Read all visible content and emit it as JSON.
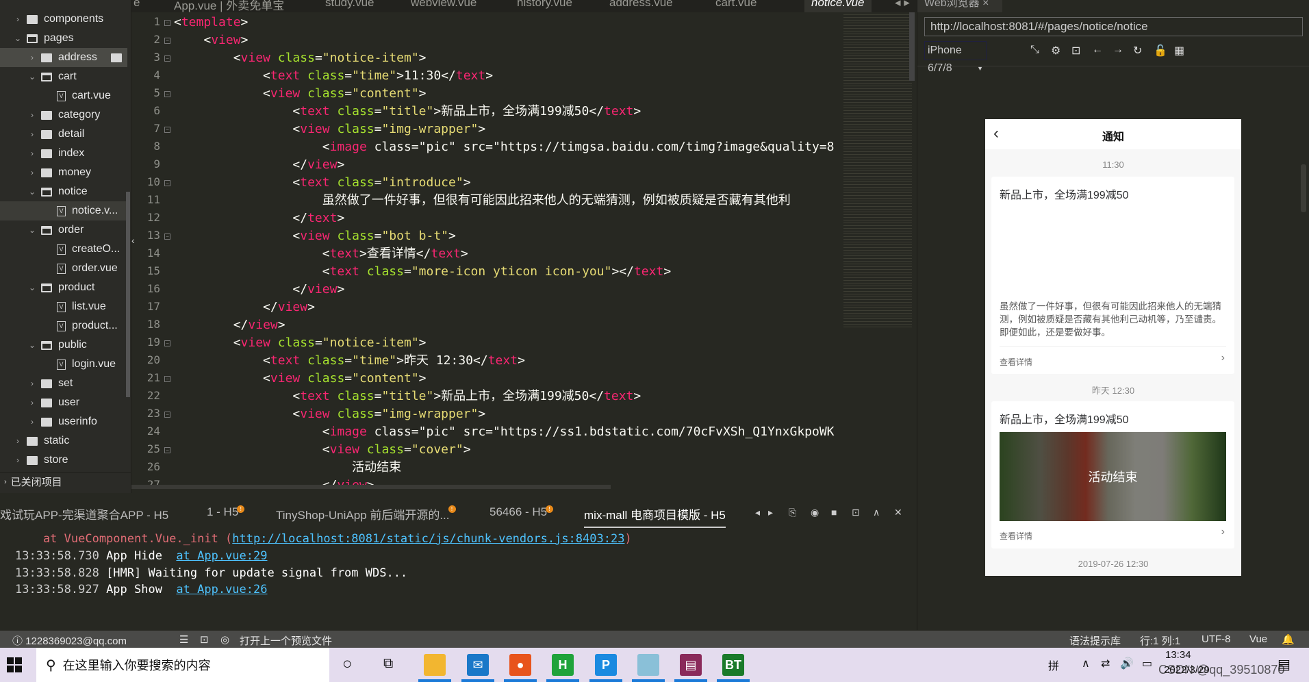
{
  "sidebar": {
    "items": [
      {
        "label": "components",
        "depth": 0,
        "kind": "folder",
        "open": false
      },
      {
        "label": "pages",
        "depth": 0,
        "kind": "folder",
        "open": true
      },
      {
        "label": "address",
        "depth": 1,
        "kind": "folder",
        "open": false,
        "selected": true
      },
      {
        "label": "cart",
        "depth": 1,
        "kind": "folder",
        "open": true
      },
      {
        "label": "cart.vue",
        "depth": 2,
        "kind": "file"
      },
      {
        "label": "category",
        "depth": 1,
        "kind": "folder",
        "open": false
      },
      {
        "label": "detail",
        "depth": 1,
        "kind": "folder",
        "open": false
      },
      {
        "label": "index",
        "depth": 1,
        "kind": "folder",
        "open": false
      },
      {
        "label": "money",
        "depth": 1,
        "kind": "folder",
        "open": false
      },
      {
        "label": "notice",
        "depth": 1,
        "kind": "folder",
        "open": true
      },
      {
        "label": "notice.v...",
        "depth": 2,
        "kind": "file",
        "active": true
      },
      {
        "label": "order",
        "depth": 1,
        "kind": "folder",
        "open": true
      },
      {
        "label": "createO...",
        "depth": 2,
        "kind": "file"
      },
      {
        "label": "order.vue",
        "depth": 2,
        "kind": "file"
      },
      {
        "label": "product",
        "depth": 1,
        "kind": "folder",
        "open": true
      },
      {
        "label": "list.vue",
        "depth": 2,
        "kind": "file"
      },
      {
        "label": "product...",
        "depth": 2,
        "kind": "file"
      },
      {
        "label": "public",
        "depth": 1,
        "kind": "folder",
        "open": true
      },
      {
        "label": "login.vue",
        "depth": 2,
        "kind": "file"
      },
      {
        "label": "set",
        "depth": 1,
        "kind": "folder",
        "open": false
      },
      {
        "label": "user",
        "depth": 1,
        "kind": "folder",
        "open": false
      },
      {
        "label": "userinfo",
        "depth": 1,
        "kind": "folder",
        "open": false
      },
      {
        "label": "static",
        "depth": 0,
        "kind": "folder",
        "open": false
      },
      {
        "label": "store",
        "depth": 0,
        "kind": "folder",
        "open": false
      }
    ],
    "closed_projects": "已关闭项目"
  },
  "editor": {
    "tabs": [
      {
        "label": "e"
      },
      {
        "label": "App.vue | 外卖免单宝"
      },
      {
        "label": "study.vue"
      },
      {
        "label": "webview.vue"
      },
      {
        "label": "history.vue"
      },
      {
        "label": "address.vue"
      },
      {
        "label": "cart.vue"
      },
      {
        "label": "notice.vue",
        "active": true
      }
    ],
    "lines": [
      "<template>",
      "    <view>",
      "        <view class=\"notice-item\">",
      "            <text class=\"time\">11:30</text>",
      "            <view class=\"content\">",
      "                <text class=\"title\">新品上市，全场满199减50</text>",
      "                <view class=\"img-wrapper\">",
      "                    <image class=\"pic\" src=\"https://timgsa.baidu.com/timg?image&quality=8",
      "                </view>",
      "                <text class=\"introduce\">",
      "                    虽然做了一件好事，但很有可能因此招来他人的无端猜测，例如被质疑是否藏有其他利",
      "                </text>",
      "                <view class=\"bot b-t\">",
      "                    <text>查看详情</text>",
      "                    <text class=\"more-icon yticon icon-you\"></text>",
      "                </view>",
      "            </view>",
      "        </view>",
      "        <view class=\"notice-item\">",
      "            <text class=\"time\">昨天 12:30</text>",
      "            <view class=\"content\">",
      "                <text class=\"title\">新品上市，全场满199减50</text>",
      "                <view class=\"img-wrapper\">",
      "                    <image class=\"pic\" src=\"https://ss1.bdstatic.com/70cFvXSh_Q1YnxGkpoWK",
      "                    <view class=\"cover\">",
      "                        活动结束",
      "                    </view>"
    ],
    "foldable": [
      1,
      2,
      3,
      5,
      7,
      10,
      13,
      19,
      21,
      23,
      25
    ]
  },
  "browser": {
    "tab_label": "Web浏览器",
    "close": "×",
    "url": "http://localhost:8081/#/pages/notice/notice",
    "device": "iPhone 6/7/8",
    "icons": [
      "rotate-icon",
      "settings-icon",
      "console-icon",
      "back-icon",
      "forward-icon",
      "refresh-icon",
      "lock-icon",
      "qrcode-icon"
    ],
    "icon_glyphs": [
      "⤡",
      "⚙",
      "⊡",
      "←",
      "→",
      "↻",
      "🔓",
      "▦"
    ]
  },
  "phone": {
    "back": "‹",
    "title": "通知",
    "items": [
      {
        "time": "11:30",
        "title": "新品上市，全场满199减50",
        "introduce": "虽然做了一件好事，但很有可能因此招来他人的无端猜测，例如被质疑是否藏有其他利己动机等，乃至谴责。即便如此，还是要做好事。",
        "more": "查看详情",
        "arrow": "›"
      },
      {
        "time": "昨天 12:30",
        "title": "新品上市，全场满199减50",
        "cover": "活动结束",
        "more": "查看详情",
        "arrow": "›"
      }
    ],
    "next_time": "2019-07-26 12:30"
  },
  "console": {
    "tabs": [
      {
        "label": "戏试玩APP-完渠道聚合APP - H5"
      },
      {
        "label": "1 - H5",
        "badge": "!"
      },
      {
        "label": "TinyShop-UniApp 前后端开源的...",
        "badge": "!"
      },
      {
        "label": "56466 - H5",
        "badge": "!"
      },
      {
        "label": "mix-mall 电商项目模版 - H5",
        "active": true
      }
    ],
    "error_prefix": "    at VueComponent.Vue._init (",
    "error_link": "http://localhost:8081/static/js/chunk-vendors.js:8403:23",
    "error_suffix": ")",
    "logs": [
      {
        "time": "13:33:58.730",
        "msg": " App Hide  ",
        "link": "at App.vue:29"
      },
      {
        "time": "13:33:58.828",
        "msg": " [HMR] Waiting for update signal from WDS...",
        "link": ""
      },
      {
        "time": "13:33:58.927",
        "msg": " App Show  ",
        "link": "at App.vue:26"
      }
    ]
  },
  "status": {
    "account": "1228369023@qq.com",
    "open_prev": "打开上一个预览文件",
    "syntax": "语法提示库",
    "position": "行:1  列:1",
    "encoding": "UTF-8",
    "language": "Vue"
  },
  "taskbar": {
    "search_placeholder": "在这里输入你要搜索的内容",
    "ime": "拼",
    "time": "13:34",
    "date": "2022/3/29",
    "watermark": "CSDN @qq_39510870",
    "apps": [
      {
        "name": "file-explorer",
        "color": "#f2b630",
        "glyph": ""
      },
      {
        "name": "mail",
        "color": "#1a78c8",
        "glyph": "✉"
      },
      {
        "name": "firefox",
        "color": "#e8541c",
        "glyph": "●"
      },
      {
        "name": "hbuilderx",
        "color": "#1fa33a",
        "glyph": "H"
      },
      {
        "name": "p-app",
        "color": "#1a8ae0",
        "glyph": "P"
      },
      {
        "name": "notepad",
        "color": "#8ac0d8",
        "glyph": ""
      },
      {
        "name": "winrar",
        "color": "#8a2a5a",
        "glyph": "▤"
      },
      {
        "name": "bt-panel",
        "color": "#1a7a2a",
        "glyph": "BT"
      }
    ]
  }
}
